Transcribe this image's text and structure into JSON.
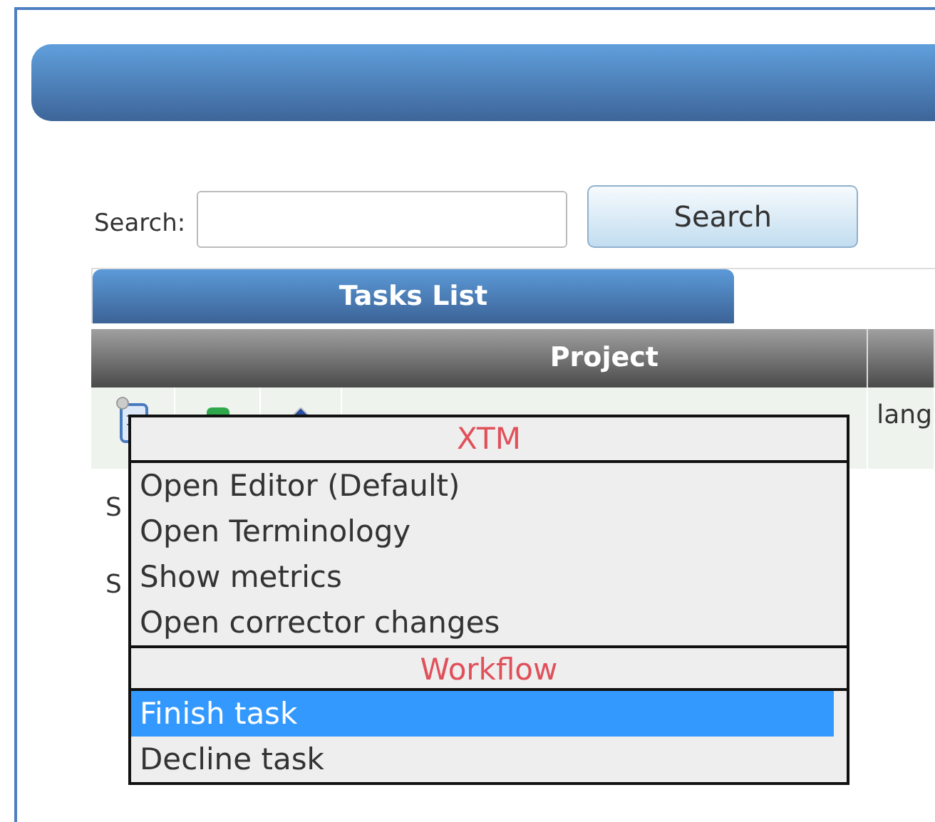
{
  "search": {
    "label": "Search:",
    "button": "Search"
  },
  "tabs": [
    {
      "label": "Tasks List",
      "selected": true
    }
  ],
  "table": {
    "columns": [
      {
        "label": "Project"
      }
    ],
    "rows": [
      {
        "kind": "task",
        "column_2": "lang"
      },
      {
        "kind": "text",
        "column_1": "S"
      },
      {
        "kind": "text",
        "column_1": "S"
      }
    ]
  },
  "context_menu": {
    "sections": [
      {
        "title": "XTM",
        "items": [
          {
            "label": "Open Editor (Default)",
            "selected": false
          },
          {
            "label": "Open Terminology",
            "selected": false
          },
          {
            "label": "Show metrics",
            "selected": false
          },
          {
            "label": "Open corrector changes",
            "selected": false
          }
        ]
      },
      {
        "title": "Workflow",
        "items": [
          {
            "label": "Finish task",
            "selected": true
          },
          {
            "label": "Decline task",
            "selected": false
          }
        ]
      }
    ]
  }
}
